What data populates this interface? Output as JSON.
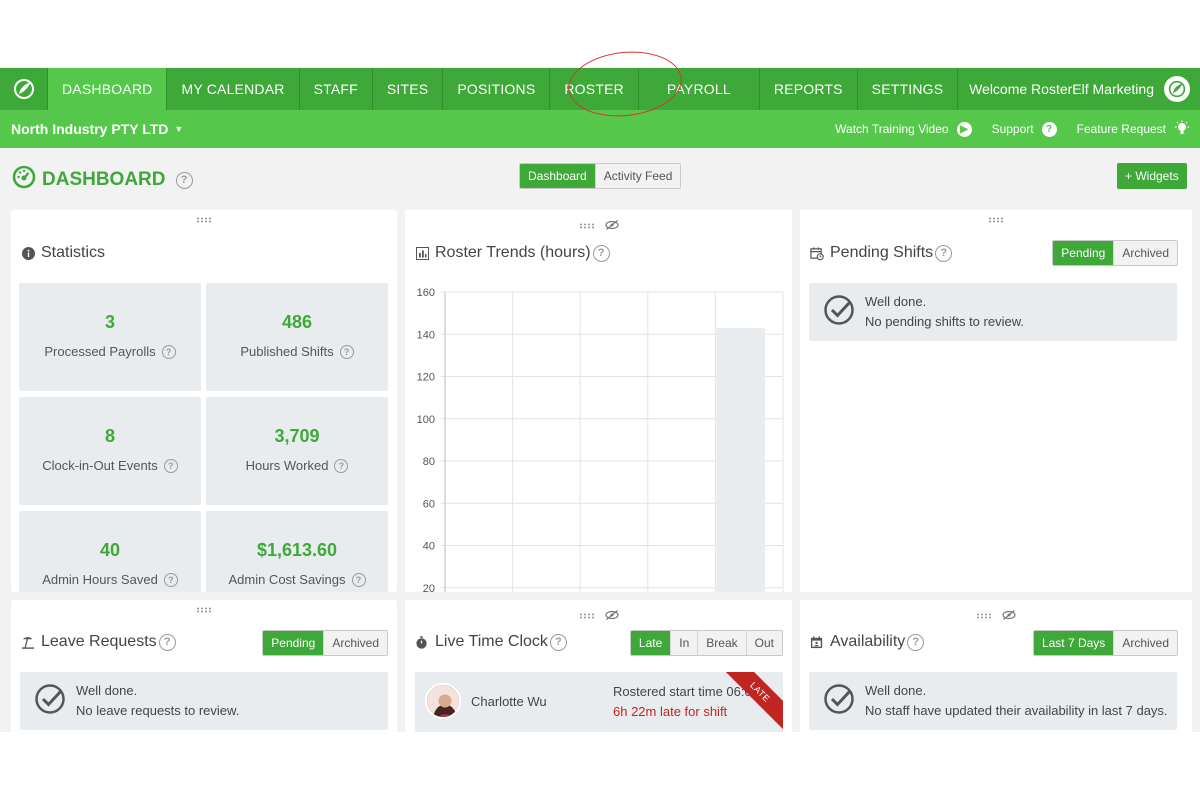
{
  "nav": {
    "items": [
      {
        "label": "DASHBOARD",
        "active": true
      },
      {
        "label": "MY CALENDAR"
      },
      {
        "label": "STAFF"
      },
      {
        "label": "SITES"
      },
      {
        "label": "POSITIONS"
      },
      {
        "label": "ROSTER"
      },
      {
        "label": "PAYROLL"
      },
      {
        "label": "REPORTS"
      },
      {
        "label": "SETTINGS"
      }
    ],
    "welcome": "Welcome RosterElf Marketing"
  },
  "subbar": {
    "company": "North Industry PTY LTD",
    "links": {
      "training": "Watch Training Video",
      "support": "Support",
      "feature": "Feature Request"
    }
  },
  "header": {
    "title": "DASHBOARD",
    "tabs": [
      "Dashboard",
      "Activity Feed"
    ],
    "widgets_button": "+ Widgets"
  },
  "statistics": {
    "title": "Statistics",
    "tiles": [
      {
        "value": "3",
        "label": "Processed Payrolls"
      },
      {
        "value": "486",
        "label": "Published Shifts"
      },
      {
        "value": "8",
        "label": "Clock-in-Out Events"
      },
      {
        "value": "3,709",
        "label": "Hours Worked"
      },
      {
        "value": "40",
        "label": "Admin Hours Saved"
      },
      {
        "value": "$1,613.60",
        "label": "Admin Cost Savings"
      }
    ]
  },
  "roster_trends": {
    "title": "Roster Trends (hours)"
  },
  "chart_data": {
    "type": "bar",
    "ylim": [
      0,
      160
    ],
    "yticks": [
      "160",
      "140",
      "120",
      "100",
      "80",
      "60",
      "40",
      "20"
    ],
    "categories": [
      "",
      "",
      "",
      "",
      ""
    ],
    "values": [
      0,
      0,
      0,
      0,
      143
    ]
  },
  "pending_shifts": {
    "title": "Pending Shifts",
    "tabs": [
      "Pending",
      "Archived"
    ],
    "notice_title": "Well done.",
    "notice_body": "No pending shifts to review."
  },
  "leave_requests": {
    "title": "Leave Requests",
    "tabs": [
      "Pending",
      "Archived"
    ],
    "notice_title": "Well done.",
    "notice_body": "No leave requests to review."
  },
  "live_time_clock": {
    "title": "Live Time Clock",
    "tabs": [
      "Late",
      "In",
      "Break",
      "Out"
    ],
    "entry": {
      "name": "Charlotte Wu",
      "rostered": "Rostered start time 06:00",
      "late": "6h 22m late for shift",
      "badge": "LATE"
    }
  },
  "availability": {
    "title": "Availability",
    "tabs": [
      "Last 7 Days",
      "Archived"
    ],
    "notice_title": "Well done.",
    "notice_body": "No staff have updated their availability in last 7 days."
  },
  "colors": {
    "nav_green": "#3ea838",
    "sub_green": "#55c84c",
    "late_red": "#c0261f",
    "annotation_red": "#d8332b"
  }
}
